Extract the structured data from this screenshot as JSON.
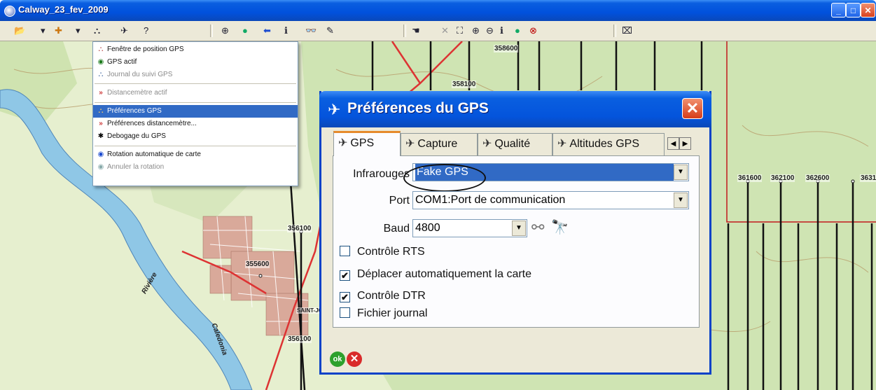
{
  "window": {
    "title": "Calway_23_fev_2009",
    "controls": [
      "_",
      "□",
      "✕"
    ]
  },
  "toolbar": {
    "tools": [
      {
        "name": "open-icon",
        "glyph": "📂"
      },
      {
        "name": "save-icon",
        "glyph": "▾"
      },
      {
        "name": "add-icon",
        "glyph": "✚"
      },
      {
        "name": "layers-icon",
        "glyph": "▾"
      },
      {
        "name": "gps-icon",
        "glyph": "⛬"
      },
      {
        "name": "satellite-icon",
        "glyph": "✈"
      },
      {
        "name": "help-icon",
        "glyph": "?"
      },
      {
        "name": "zoom-icon",
        "glyph": "⊕"
      },
      {
        "name": "globe-icon",
        "glyph": "●"
      },
      {
        "name": "back-icon",
        "glyph": "⬅"
      },
      {
        "name": "info-icon",
        "glyph": "ℹ"
      },
      {
        "name": "binoculars-icon",
        "glyph": "👓"
      },
      {
        "name": "pencil-icon",
        "glyph": "✎"
      }
    ],
    "right_tools": [
      {
        "name": "cursor-icon",
        "glyph": "☚"
      },
      {
        "name": "close-tool-icon",
        "glyph": "✕"
      },
      {
        "name": "zoom-extent-icon",
        "glyph": "⛶"
      },
      {
        "name": "zoom-in-icon",
        "glyph": "⊕"
      },
      {
        "name": "zoom-out-icon",
        "glyph": "⊖"
      },
      {
        "name": "info-tool-icon",
        "glyph": "ℹ"
      },
      {
        "name": "globe-tool-icon",
        "glyph": "●"
      },
      {
        "name": "stop-icon",
        "glyph": "⊗"
      },
      {
        "name": "grid-icon",
        "glyph": "⌧"
      }
    ]
  },
  "map": {
    "labels": [
      "358600",
      "358100",
      "361600",
      "362100",
      "362600",
      "3631",
      "356100",
      "355600",
      "356100",
      "SAINT-JO",
      "Rivière",
      "Caledonia"
    ]
  },
  "menu": {
    "items": [
      {
        "label": "Fenêtre de position GPS",
        "icon": "⛬",
        "enabled": true
      },
      {
        "label": "GPS actif",
        "icon": "◉",
        "enabled": true
      },
      {
        "label": "Journal du suivi GPS",
        "icon": "⛬",
        "enabled": false
      },
      {
        "sep": true
      },
      {
        "label": "Distancemètre actif",
        "icon": "»",
        "enabled": false
      },
      {
        "sep": true
      },
      {
        "label": "Préférences GPS",
        "icon": "⛬",
        "enabled": true,
        "selected": true
      },
      {
        "label": "Préférences distancemètre...",
        "icon": "»",
        "enabled": true
      },
      {
        "label": "Debogage du GPS",
        "icon": "✱",
        "enabled": true
      },
      {
        "sep": true
      },
      {
        "label": "Rotation automatique de carte",
        "icon": "◉",
        "enabled": true
      },
      {
        "label": "Annuler la rotation",
        "icon": "◉",
        "enabled": false
      }
    ]
  },
  "dialog": {
    "title": "Préférences du GPS",
    "tabs": [
      "GPS",
      "Capture",
      "Qualité",
      "Altitudes GPS"
    ],
    "fields": {
      "infrarouges_label": "Infrarouges",
      "infrarouges_value": "Fake GPS",
      "port_label": "Port",
      "port_value": "COM1:Port de communication",
      "baud_label": "Baud",
      "baud_value": "4800"
    },
    "checkboxes": [
      {
        "label": "Contrôle RTS",
        "checked": false
      },
      {
        "label": "Déplacer automatiquement la carte",
        "checked": true
      },
      {
        "label": "Contrôle DTR",
        "checked": true
      },
      {
        "label": "Fichier journal",
        "checked": false
      }
    ],
    "ok_label": "ok",
    "cancel_label": "✕"
  }
}
